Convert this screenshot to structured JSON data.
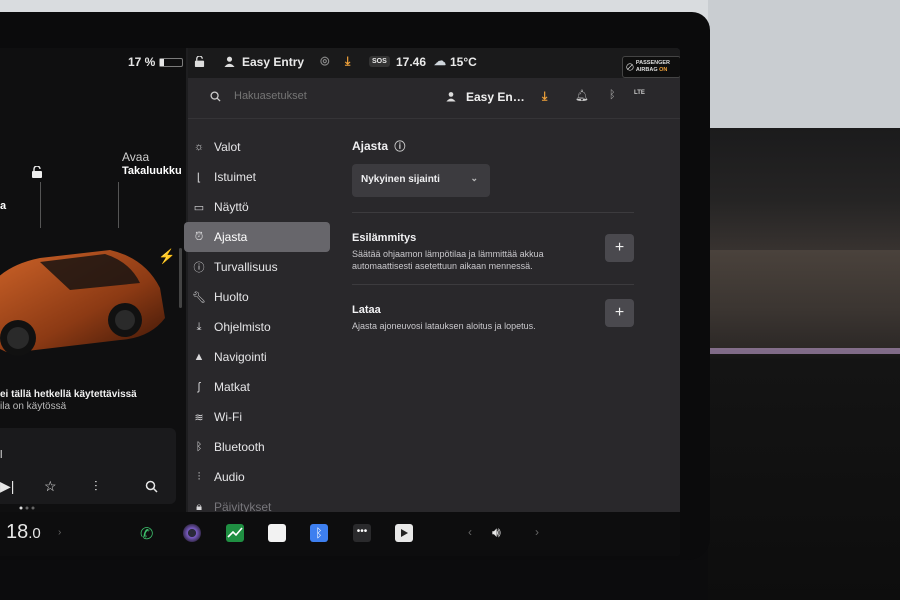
{
  "status": {
    "battery_percent": "17 %",
    "battery_level": 0.17,
    "profile_name": "Easy Entry",
    "time": "17.46",
    "temperature": "15°C",
    "sos_label": "SOS",
    "airbag_label": "PASSENGER AIRBAG",
    "airbag_state": "ON"
  },
  "car": {
    "trunk_action": "Avaa",
    "trunk_name": "Takaluukku",
    "frunk_partial": "a",
    "warning_title": "ei tällä hetkellä käytettävissä",
    "warning_sub": "ila on käytössä",
    "media_label": "l"
  },
  "search": {
    "placeholder": "Hakuasetukset",
    "profile_short": "Easy En…",
    "signal_label": "LTE"
  },
  "menu": {
    "items": [
      {
        "label": "Valot",
        "icon": "sun-icon"
      },
      {
        "label": "Istuimet",
        "icon": "seat-icon"
      },
      {
        "label": "Näyttö",
        "icon": "display-icon"
      },
      {
        "label": "Ajasta",
        "icon": "alarm-clock-icon"
      },
      {
        "label": "Turvallisuus",
        "icon": "info-circle-icon"
      },
      {
        "label": "Huolto",
        "icon": "wrench-icon"
      },
      {
        "label": "Ohjelmisto",
        "icon": "download-icon"
      },
      {
        "label": "Navigointi",
        "icon": "navigation-icon"
      },
      {
        "label": "Matkat",
        "icon": "trips-icon"
      },
      {
        "label": "Wi-Fi",
        "icon": "wifi-icon"
      },
      {
        "label": "Bluetooth",
        "icon": "bluetooth-icon"
      },
      {
        "label": "Audio",
        "icon": "equalizer-icon"
      },
      {
        "label": "Päivitykset",
        "icon": "lock-icon"
      }
    ],
    "active_index": 3
  },
  "content": {
    "title": "Ajasta",
    "location_value": "Nykyinen sijainti",
    "preheat_title": "Esilämmitys",
    "preheat_desc": "Säätää ohjaamon lämpötilaa ja lämmittää akkua automaattisesti asetettuun aikaan mennessä.",
    "charge_title": "Lataa",
    "charge_desc": "Ajasta ajoneuvosi latauksen aloitus ja lopetus.",
    "plus_symbol": "+"
  },
  "dock": {
    "cabin_temp_int": "18",
    "cabin_temp_dec": ".0",
    "apps": [
      "phone-icon",
      "camera-icon",
      "stocks-icon",
      "notes-icon",
      "bluetooth-app-icon",
      "more-icon",
      "video-icon"
    ]
  },
  "colors": {
    "accent_orange": "#f0a23a",
    "active_menu_bg": "#67666b",
    "panel_bg": "#29282b"
  }
}
